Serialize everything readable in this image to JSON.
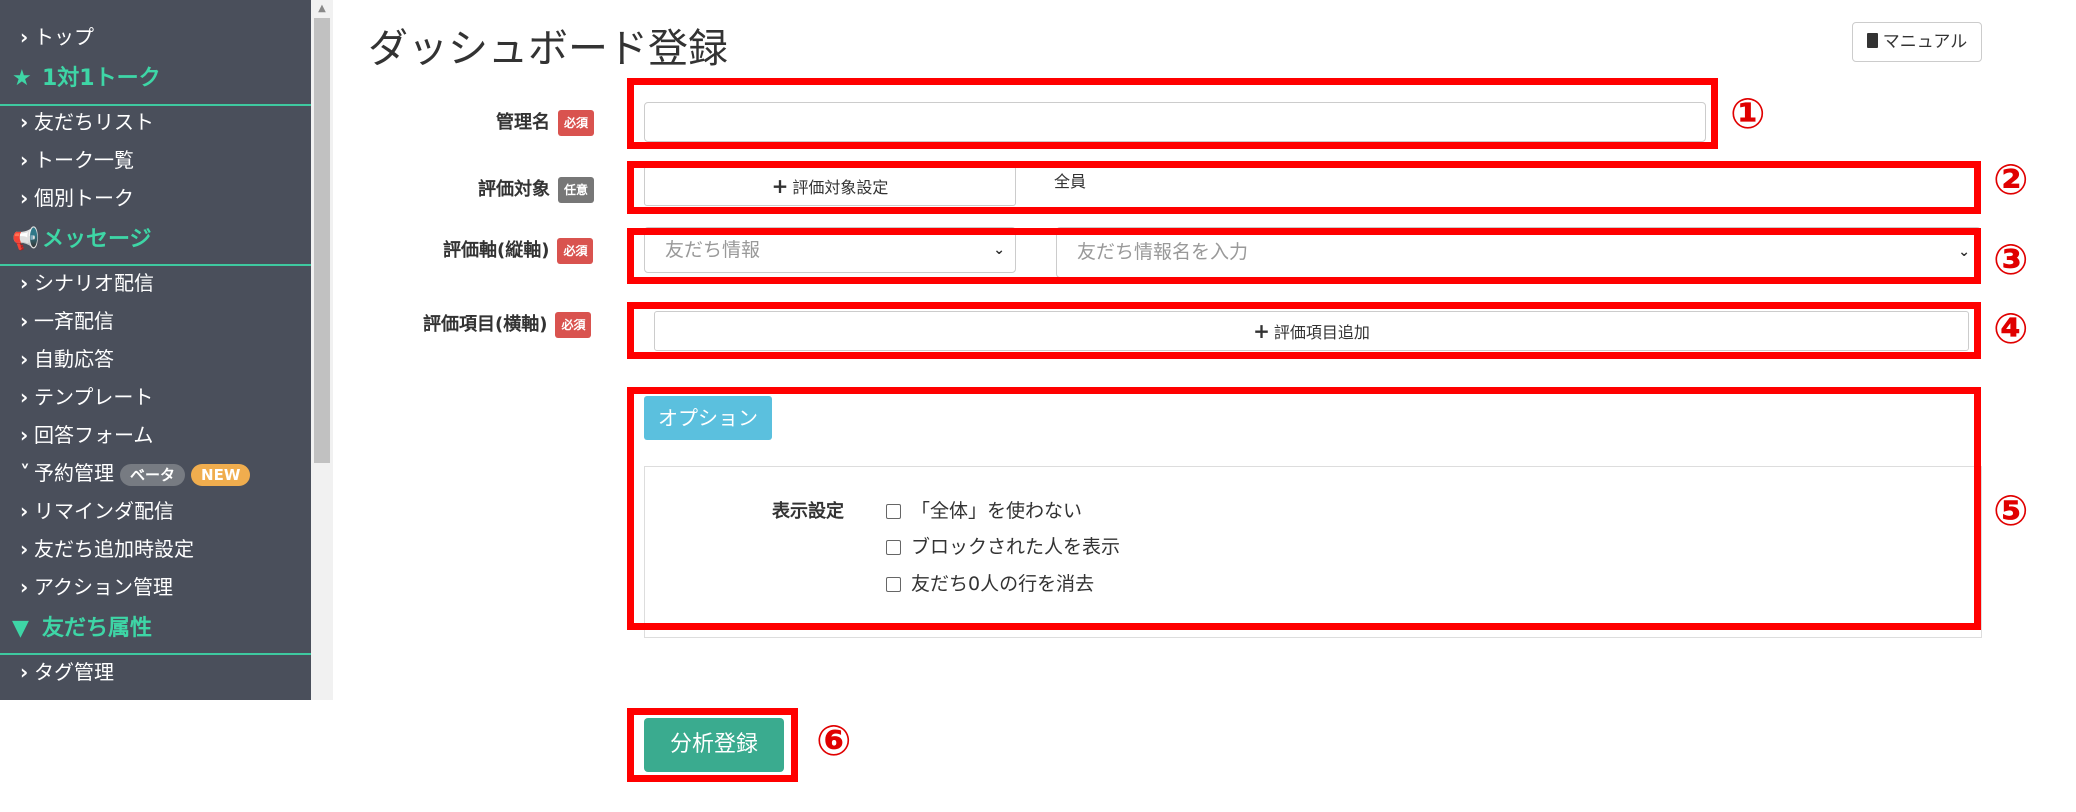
{
  "sidebar": {
    "items": [
      {
        "label": "トップ"
      },
      {
        "label": "友だちリスト"
      },
      {
        "label": "トーク一覧"
      },
      {
        "label": "個別トーク"
      },
      {
        "label": "シナリオ配信"
      },
      {
        "label": "一斉配信"
      },
      {
        "label": "自動応答"
      },
      {
        "label": "テンプレート"
      },
      {
        "label": "回答フォーム"
      },
      {
        "label": "予約管理",
        "badge_beta": "ベータ",
        "badge_new": "NEW"
      },
      {
        "label": "リマインダ配信"
      },
      {
        "label": "友だち追加時設定"
      },
      {
        "label": "アクション管理"
      },
      {
        "label": "タグ管理"
      }
    ],
    "sections": [
      {
        "label": "1対1トーク",
        "icon": "star-icon"
      },
      {
        "label": "メッセージ",
        "icon": "megaphone-icon"
      },
      {
        "label": "友だち属性",
        "icon": "filter-icon"
      }
    ]
  },
  "header": {
    "title": "ダッシュボード登録",
    "manual_label": "マニュアル"
  },
  "form": {
    "name_label": "管理名",
    "required": "必須",
    "optional": "任意",
    "target_label": "評価対象",
    "target_button": "評価対象設定",
    "target_value": "全員",
    "axis_label": "評価軸(縦軸)",
    "axis_select": "友だち情報",
    "axis_input_placeholder": "友だち情報名を入力",
    "items_label": "評価項目(横軸)",
    "items_button": "評価項目追加",
    "option_button": "オプション",
    "display_label": "表示設定",
    "checkboxes": [
      "「全体」を使わない",
      "ブロックされた人を表示",
      "友だち0人の行を消去"
    ],
    "submit": "分析登録"
  },
  "annotations": [
    "①",
    "②",
    "③",
    "④",
    "⑤",
    "⑥"
  ],
  "colors": {
    "sidebar_bg": "#4a4f5b",
    "accent_green": "#3ed6a6",
    "annotation_red": "#ff0000",
    "submit_green": "#3aab8f",
    "option_blue": "#5bc0de"
  }
}
